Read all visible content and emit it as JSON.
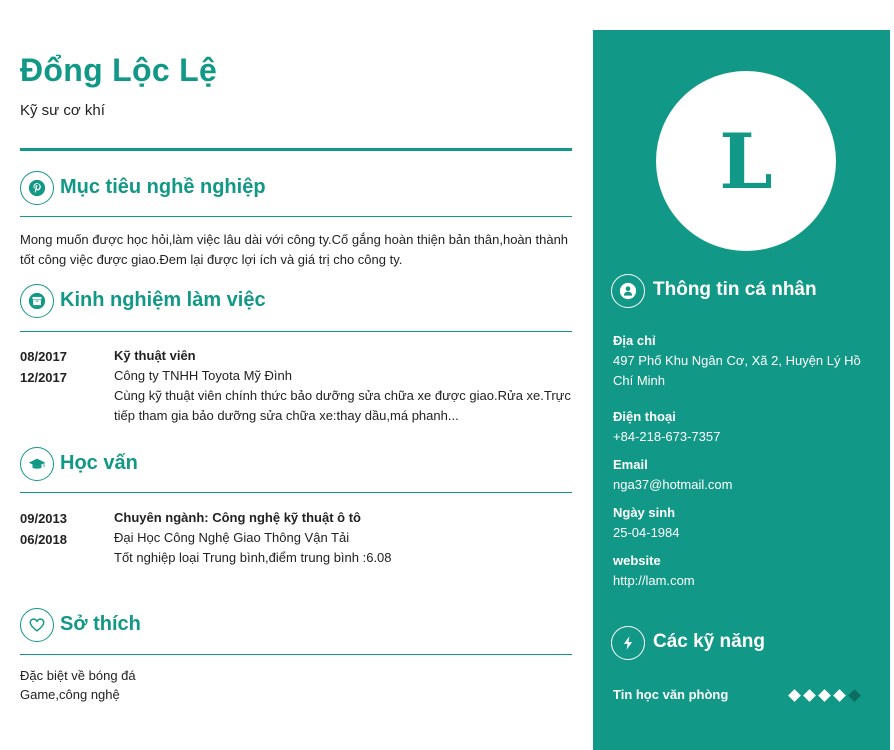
{
  "profile": {
    "name": "Đổng Lộc Lệ",
    "title": "Kỹ sư cơ khí",
    "avatar_letter": "L"
  },
  "sections": {
    "objective": {
      "title": "Mục tiêu nghề nghiệp",
      "icon": "pinterest-icon",
      "text": "Mong muốn được học hỏi,làm việc lâu dài với công ty.Cố gắng hoàn thiện bản thân,hoàn thành tốt công việc được giao.Đem lại được lợi ích và giá trị cho công ty."
    },
    "experience": {
      "title": "Kinh nghiệm làm việc",
      "icon": "archive-icon",
      "items": [
        {
          "start": "08/2017",
          "end": "12/2017",
          "role": "Kỹ thuật viên",
          "org": "Công ty TNHH Toyota Mỹ Đình",
          "desc": "Cùng kỹ thuật viên chính thức bảo dưỡng sửa chữa xe được giao.Rửa xe.Trực tiếp tham gia bảo dưỡng sửa chữa xe:thay dầu,má phanh..."
        }
      ]
    },
    "education": {
      "title": "Học vấn",
      "icon": "graduation-cap-icon",
      "items": [
        {
          "start": "09/2013",
          "end": "06/2018",
          "role": "Chuyên ngành: Công nghệ kỹ thuật ô tô",
          "org": "Đại Học Công Nghệ Giao Thông Vận Tải",
          "desc": "Tốt nghiệp loại Trung bình,điểm trung bình :6.08"
        }
      ]
    },
    "hobbies": {
      "title": "Sở thích",
      "icon": "heart-icon",
      "lines": [
        "Đặc biệt về bóng đá",
        "Game,công nghệ"
      ]
    }
  },
  "personal": {
    "title": "Thông tin cá nhân",
    "icon": "user-icon",
    "address_label": "Địa chỉ",
    "address": "497 Phố Khu Ngân Cơ, Xã 2, Huyện Lý Hồ Chí Minh",
    "phone_label": "Điện thoại",
    "phone": "+84-218-673-7357",
    "email_label": "Email",
    "email": "nga37@hotmail.com",
    "dob_label": "Ngày sinh",
    "dob": "25-04-1984",
    "website_label": "website",
    "website": "http://lam.com"
  },
  "skills": {
    "title": "Các kỹ năng",
    "icon": "bolt-icon",
    "items": [
      {
        "name": "Tin học văn phòng",
        "level": 4,
        "max": 5
      }
    ]
  },
  "colors": {
    "accent": "#129886",
    "dot_inactive": "#0c6d60"
  }
}
